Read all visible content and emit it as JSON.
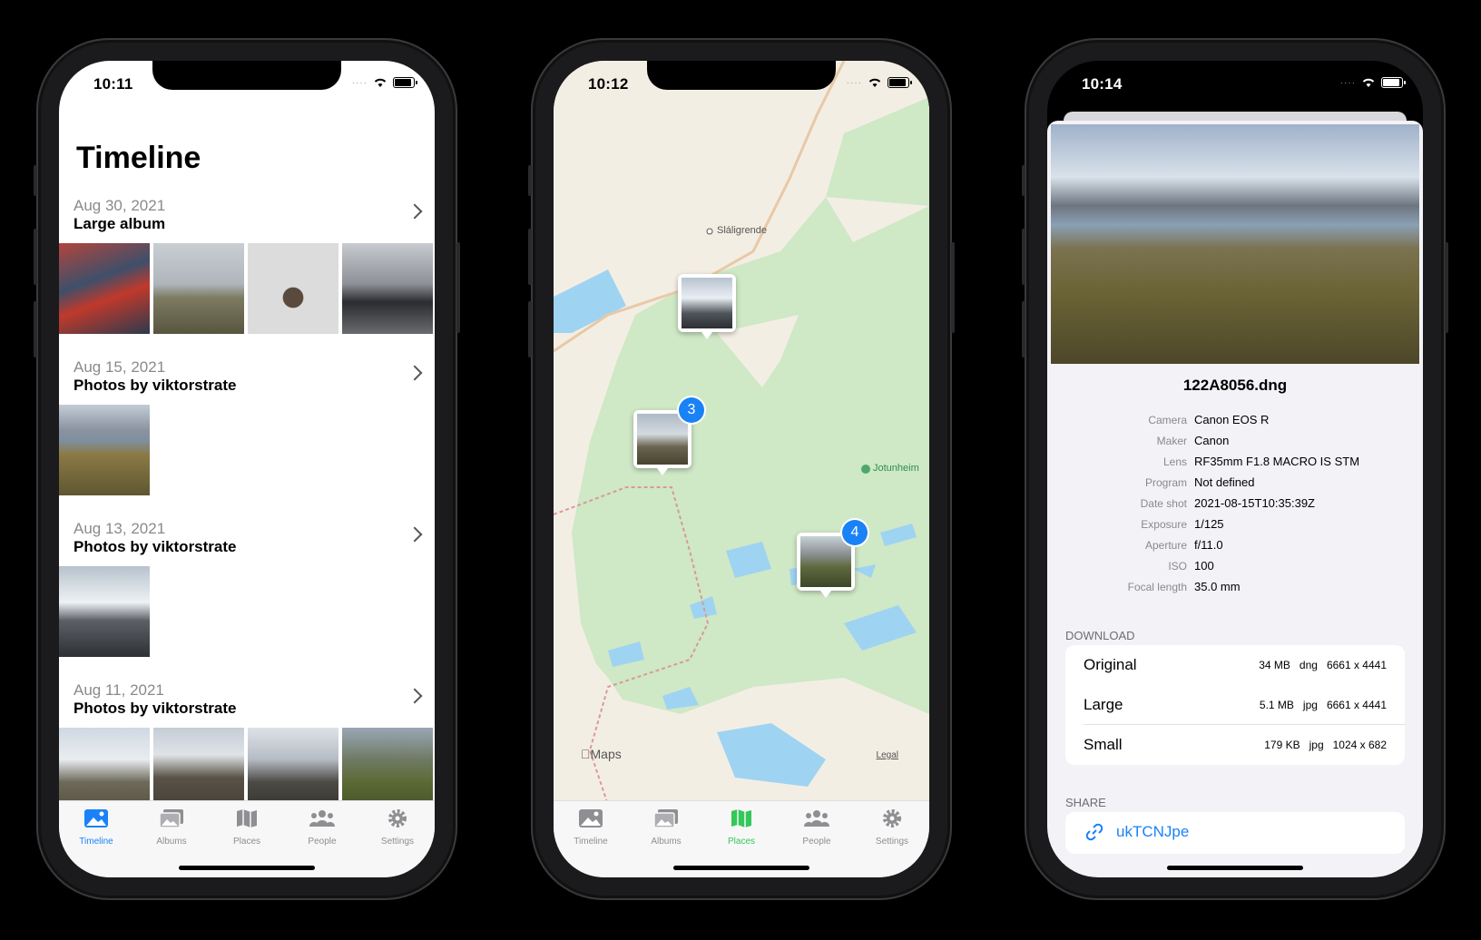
{
  "phone1": {
    "time": "10:11",
    "title": "Timeline",
    "sections": [
      {
        "date": "Aug 30, 2021",
        "name": "Large album"
      },
      {
        "date": "Aug 15, 2021",
        "name": "Photos by viktorstrate"
      },
      {
        "date": "Aug 13, 2021",
        "name": "Photos by viktorstrate"
      },
      {
        "date": "Aug 11, 2021",
        "name": "Photos by viktorstrate"
      }
    ]
  },
  "phone2": {
    "time": "10:12",
    "place_label": "Sláligrende",
    "poi_label": "Jotunheim",
    "maps_label": "Maps",
    "legal_label": "Legal",
    "pin_badges": [
      "3",
      "4"
    ]
  },
  "phone3": {
    "time": "10:14",
    "filename": "122A8056.dng",
    "meta": [
      {
        "k": "Camera",
        "v": "Canon EOS R"
      },
      {
        "k": "Maker",
        "v": "Canon"
      },
      {
        "k": "Lens",
        "v": "RF35mm F1.8 MACRO IS STM"
      },
      {
        "k": "Program",
        "v": "Not defined"
      },
      {
        "k": "Date shot",
        "v": "2021-08-15T10:35:39Z"
      },
      {
        "k": "Exposure",
        "v": "1/125"
      },
      {
        "k": "Aperture",
        "v": "f/11.0"
      },
      {
        "k": "ISO",
        "v": "100"
      },
      {
        "k": "Focal length",
        "v": "35.0 mm"
      }
    ],
    "download_header": "DOWNLOAD",
    "downloads": [
      {
        "name": "Original",
        "info": "34 MB   dng   6661 x 4441"
      },
      {
        "name": "Large",
        "info": "5.1 MB   jpg   6661 x 4441"
      },
      {
        "name": "Small",
        "info": "179 KB   jpg   1024 x 682"
      }
    ],
    "share_header": "SHARE",
    "share_link": "ukTCNJpe"
  },
  "tabs": [
    "Timeline",
    "Albums",
    "Places",
    "People",
    "Settings"
  ],
  "colors": {
    "accent": "#1a82f7",
    "places_active": "#34c759",
    "map_green": "#cfe8c6",
    "map_water": "#9fd3f2"
  }
}
